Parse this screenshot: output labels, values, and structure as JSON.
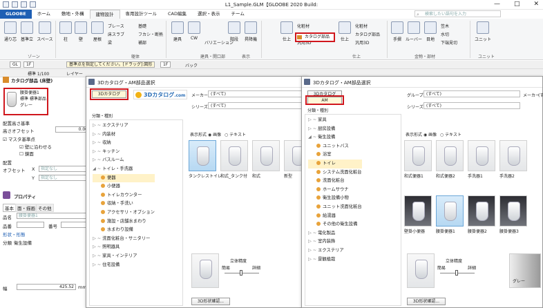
{
  "window": {
    "title": "L1_Sample.GLM【GLOOBE 2020 Build:",
    "minimize": "—",
    "restore": "□",
    "close": "✕"
  },
  "ribbon_tabs": [
    "GLOOBE",
    "ホーム",
    "敷地・外構",
    "建物設計",
    "専用設計ツール",
    "CAD編集",
    "選択・表示",
    "チーム"
  ],
  "search_placeholder": "検索したい語句を入力",
  "ribbon": {
    "buttons": [
      {
        "label": "通り芯"
      },
      {
        "label": "基準立"
      },
      {
        "label": "スペース"
      },
      {
        "label": "柱"
      },
      {
        "label": "壁"
      },
      {
        "label": "屋根"
      },
      {
        "label": "建具"
      },
      {
        "label": "CW"
      },
      {
        "label": "階段"
      },
      {
        "label": "昇降機"
      },
      {
        "label": "仕上"
      },
      {
        "label": "仕上"
      },
      {
        "label": "手摺"
      },
      {
        "label": "ルーバー"
      },
      {
        "label": "目地"
      },
      {
        "label": "ユニット"
      }
    ],
    "small": {
      "brace": "ブレース",
      "slab": "床スラブ",
      "curtain": "フカシ・断熱",
      "beam": "梁",
      "pitch": "補部",
      "foundation": "基礎",
      "part": "化粧材",
      "catalog": "カタログ部品",
      "part2": "化粧材",
      "catalog2": "カタログ部品",
      "part3d": "汎用3D",
      "wood": "笠木",
      "drain": "水切",
      "eaves": "下端見切",
      "variation": "バリエーション"
    },
    "groups": [
      "ゾーン",
      "躯体",
      "建具・開口部",
      "表示",
      "仕上",
      "家具",
      "金物・部材",
      "ユニット"
    ],
    "catalog_button": "カタログ部品"
  },
  "toolbar1": {
    "gl": "GL",
    "floor": "1F",
    "hint": "基準点を指定してください。[ドラッグ]:図形",
    "floor2": "1F",
    "back": "バック"
  },
  "toolbar2": {
    "scale": "標準 1/100",
    "layer": "レイヤー"
  },
  "left_panel": {
    "header": "カタログ部品 (床壁)",
    "part_name": [
      "腰掛便器1",
      "標準 標準部品",
      "グレー"
    ],
    "layout_label": "配置高さ基準",
    "height_offset_label": "高さオフセット",
    "height_offset_value": "0.00",
    "master_check": "マスタ基準点",
    "wall_fit": "壁に沿わせる",
    "mirror": "鏡面",
    "placement_label": "配置",
    "offset_label": "オフセット",
    "x_label": "X",
    "y_label": "Y",
    "unspecified": "指定なし",
    "property_header": "プロパティ",
    "prop_tabs": [
      "基本",
      "面・描画",
      "その他"
    ],
    "name_label": "品名",
    "name_value": "腰掛便器1",
    "number_label": "品番",
    "code_label": "番号",
    "shape_label": "形状・形態",
    "category_label": "分類",
    "category_value": "衛生設備",
    "width_label": "幅",
    "width_value": "425.52",
    "width_unit": "mm"
  },
  "dialog1": {
    "title": "3Dカタログ・AM部品選択",
    "tab_selected": "3Dカタログ",
    "logo_text": "3Dカタログ",
    "logo_suffix": ".com",
    "maker_label": "メーカー",
    "maker_value": "(すべて)",
    "series_label": "シリーズ",
    "series_value": "(すべて)",
    "category_header": "分類・種別",
    "display_label": "表示形式",
    "display_image": "画像",
    "display_text": "テキスト",
    "tree": [
      {
        "text": "エクステリア",
        "indent": 0,
        "leaf": false
      },
      {
        "text": "内装材",
        "indent": 0,
        "leaf": false
      },
      {
        "text": "収納",
        "indent": 0,
        "leaf": false
      },
      {
        "text": "キッチン",
        "indent": 0,
        "leaf": false
      },
      {
        "text": "バスルーム",
        "indent": 0,
        "leaf": false
      },
      {
        "text": "トイレ・手洗器",
        "indent": 0,
        "leaf": false,
        "open": true
      },
      {
        "text": "便器",
        "indent": 1,
        "leaf": true,
        "selected": true
      },
      {
        "text": "小便器",
        "indent": 1,
        "leaf": true
      },
      {
        "text": "トイレカウンター",
        "indent": 1,
        "leaf": true
      },
      {
        "text": "収納・手洗い",
        "indent": 1,
        "leaf": true
      },
      {
        "text": "アクセサリ・オプション",
        "indent": 1,
        "leaf": true
      },
      {
        "text": "施設・店舗水まわり",
        "indent": 1,
        "leaf": true
      },
      {
        "text": "水まわり設備",
        "indent": 1,
        "leaf": true
      },
      {
        "text": "洗面化粧台・サニタリー",
        "indent": 0,
        "leaf": false
      },
      {
        "text": "照明器具",
        "indent": 0,
        "leaf": false
      },
      {
        "text": "家具・インテリア",
        "indent": 0,
        "leaf": false
      },
      {
        "text": "住宅設備",
        "indent": 0,
        "leaf": false
      }
    ],
    "thumbs": [
      "タンクレストイレ",
      "和式_タンク付",
      "和式",
      "新型"
    ],
    "detail_label": "立体精度",
    "simple": "簡易",
    "detailed": "詳細",
    "confirm_button": "3D形状確認..."
  },
  "dialog2": {
    "title": "3Dカタログ・AM部品選択",
    "tab_top": "3Dカタログ",
    "tab_selected": "AM",
    "group_label": "グループ",
    "group_value": "(すべて)",
    "maker_label": "メーカー",
    "maker_value": "(す",
    "series_label": "シリーズ",
    "series_value": "(すべて)",
    "category_header": "分類・種別",
    "display_label": "表示形式",
    "display_image": "画像",
    "display_text": "テキスト",
    "tree": [
      {
        "text": "家具",
        "indent": 0,
        "leaf": false
      },
      {
        "text": "厨房設備",
        "indent": 0,
        "leaf": false
      },
      {
        "text": "衛生設備",
        "indent": 0,
        "leaf": false,
        "open": true
      },
      {
        "text": "ユニットバス",
        "indent": 1,
        "leaf": true
      },
      {
        "text": "浴室",
        "indent": 1,
        "leaf": true
      },
      {
        "text": "トイレ",
        "indent": 1,
        "leaf": true,
        "selected": true
      },
      {
        "text": "システム洗面化粧台",
        "indent": 1,
        "leaf": true
      },
      {
        "text": "洗面化粧台",
        "indent": 1,
        "leaf": true
      },
      {
        "text": "ホームサウナ",
        "indent": 1,
        "leaf": true
      },
      {
        "text": "衛生設備小物",
        "indent": 1,
        "leaf": true
      },
      {
        "text": "ユニット洗面化粧台",
        "indent": 1,
        "leaf": true
      },
      {
        "text": "給湯器",
        "indent": 1,
        "leaf": true
      },
      {
        "text": "その他の衛生設備",
        "indent": 1,
        "leaf": true
      },
      {
        "text": "電化製品",
        "indent": 0,
        "leaf": false
      },
      {
        "text": "室内装飾",
        "indent": 0,
        "leaf": false
      },
      {
        "text": "エクステリア",
        "indent": 0,
        "leaf": false
      },
      {
        "text": "景観植栽",
        "indent": 0,
        "leaf": false
      }
    ],
    "thumbs_row1": [
      "和式便器1",
      "和式便器2",
      "手洗器1",
      "手洗器2"
    ],
    "thumbs_row2": [
      "壁掛小便器",
      "腰掛便器1",
      "腰掛便器2",
      "腰掛便器3"
    ],
    "detail_label": "立体精度",
    "simple": "簡易",
    "detailed": "詳細",
    "color_label": "グレー",
    "confirm_button": "3D形状確認..."
  }
}
